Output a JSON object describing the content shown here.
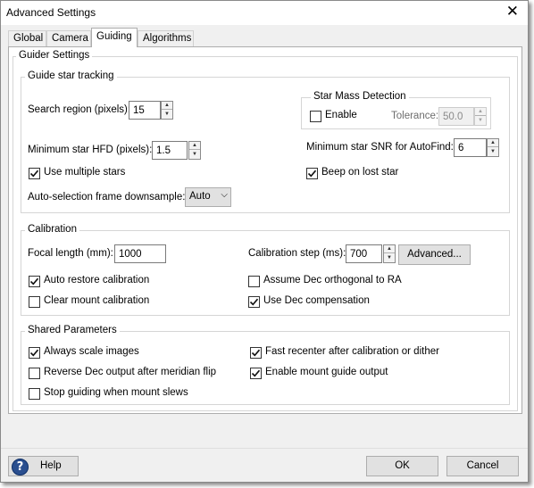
{
  "window": {
    "title": "Advanced Settings",
    "close_glyph": "✕"
  },
  "tabs": [
    "Global",
    "Camera",
    "Guiding",
    "Algorithms"
  ],
  "active_tab": "Guiding",
  "guider_settings": {
    "label": "Guider Settings",
    "tracking": {
      "label": "Guide star tracking",
      "search_region_label": "Search region (pixels):",
      "search_region_value": "15",
      "min_hfd_label": "Minimum star HFD (pixels):",
      "min_hfd_value": "1.5",
      "use_multiple_stars_label": "Use multiple stars",
      "use_multiple_stars_checked": true,
      "downsample_label": "Auto-selection frame downsample:",
      "downsample_value": "Auto",
      "star_mass": {
        "label": "Star Mass Detection",
        "enable_label": "Enable",
        "enable_checked": false,
        "tolerance_label": "Tolerance:",
        "tolerance_value": "50.0"
      },
      "min_snr_label": "Minimum star SNR for AutoFind:",
      "min_snr_value": "6",
      "beep_label": "Beep on lost star",
      "beep_checked": true
    },
    "calibration": {
      "label": "Calibration",
      "focal_length_label": "Focal length (mm):",
      "focal_length_value": "1000",
      "cal_step_label": "Calibration step (ms):",
      "cal_step_value": "700",
      "advanced_button": "Advanced...",
      "auto_restore_label": "Auto restore calibration",
      "auto_restore_checked": true,
      "clear_mount_label": "Clear mount calibration",
      "clear_mount_checked": false,
      "assume_dec_label": "Assume Dec orthogonal to RA",
      "assume_dec_checked": false,
      "use_dec_comp_label": "Use Dec compensation",
      "use_dec_comp_checked": true
    },
    "shared": {
      "label": "Shared Parameters",
      "always_scale_label": "Always scale images",
      "always_scale_checked": true,
      "reverse_dec_label": "Reverse Dec output after meridian flip",
      "reverse_dec_checked": false,
      "stop_guiding_label": "Stop guiding when mount slews",
      "stop_guiding_checked": false,
      "fast_recenter_label": "Fast recenter after calibration or dither",
      "fast_recenter_checked": true,
      "enable_mount_label": "Enable mount guide output",
      "enable_mount_checked": true
    }
  },
  "footer": {
    "help_label": "Help",
    "help_icon": "?",
    "ok_label": "OK",
    "cancel_label": "Cancel"
  },
  "colors": {
    "help_icon_bg": "#2a4f8f",
    "window_bg": "#f0f0f0",
    "panel_bg": "#ffffff"
  }
}
